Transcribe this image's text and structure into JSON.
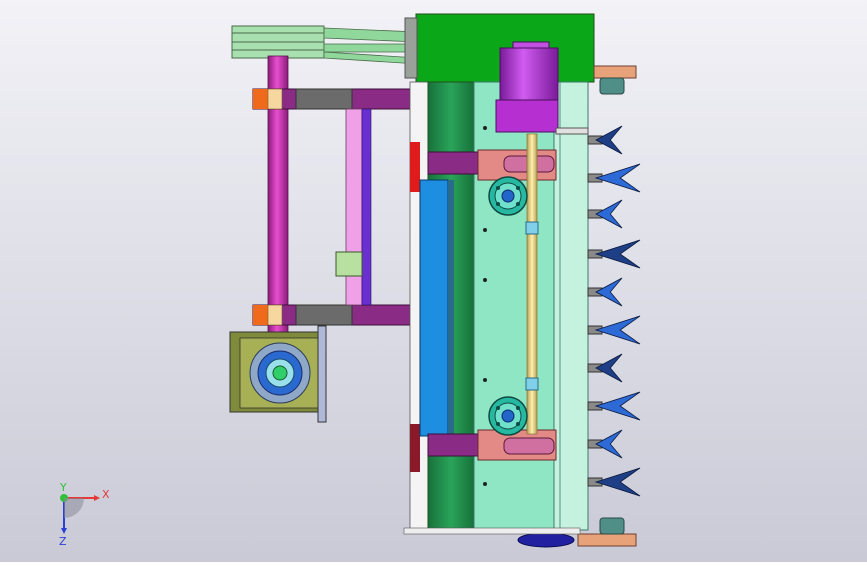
{
  "viewport": {
    "background_top": "#f2f2f7",
    "background_bottom": "#c9cad6"
  },
  "triad": {
    "x_label": "X",
    "y_label": "Y",
    "z_label": "Z",
    "x_color": "#e53935",
    "y_color": "#2fbf3b",
    "z_color": "#2a3fd6"
  },
  "colors": {
    "frame_green": "#0aa818",
    "motor_magenta": "#b62fd1",
    "beam_purple": "#8a2b86",
    "shaft_magenta": "#d329b8",
    "roller_green": "#1f8f48",
    "roller_mint": "#8fe6c4",
    "panel_blue": "#1d8ee0",
    "bracket_salmon": "#e48a86",
    "gear_teal": "#27b8a2",
    "sprocket_blue": "#2166c8",
    "gearbox_olive": "#7f8a3a",
    "pulley_green": "#8fd79a",
    "tine_navy": "#1e3f86",
    "tine_blue": "#2d6ad6",
    "flange_peach": "#e8a27a",
    "highlight_red": "#e01b1b"
  },
  "icons": {
    "triad": "coordinate-axes-icon"
  }
}
